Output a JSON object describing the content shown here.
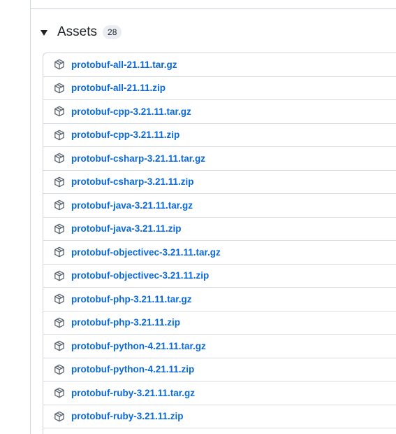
{
  "assets": {
    "title": "Assets",
    "count": "28",
    "items": [
      {
        "name": "protobuf-all-21.11.tar.gz",
        "icon": "package-icon"
      },
      {
        "name": "protobuf-all-21.11.zip",
        "icon": "package-icon"
      },
      {
        "name": "protobuf-cpp-3.21.11.tar.gz",
        "icon": "package-icon"
      },
      {
        "name": "protobuf-cpp-3.21.11.zip",
        "icon": "package-icon"
      },
      {
        "name": "protobuf-csharp-3.21.11.tar.gz",
        "icon": "package-icon"
      },
      {
        "name": "protobuf-csharp-3.21.11.zip",
        "icon": "package-icon"
      },
      {
        "name": "protobuf-java-3.21.11.tar.gz",
        "icon": "package-icon"
      },
      {
        "name": "protobuf-java-3.21.11.zip",
        "icon": "package-icon"
      },
      {
        "name": "protobuf-objectivec-3.21.11.tar.gz",
        "icon": "package-icon"
      },
      {
        "name": "protobuf-objectivec-3.21.11.zip",
        "icon": "package-icon"
      },
      {
        "name": "protobuf-php-3.21.11.tar.gz",
        "icon": "package-icon"
      },
      {
        "name": "protobuf-php-3.21.11.zip",
        "icon": "package-icon"
      },
      {
        "name": "protobuf-python-4.21.11.tar.gz",
        "icon": "package-icon"
      },
      {
        "name": "protobuf-python-4.21.11.zip",
        "icon": "package-icon"
      },
      {
        "name": "protobuf-ruby-3.21.11.tar.gz",
        "icon": "package-icon"
      },
      {
        "name": "protobuf-ruby-3.21.11.zip",
        "icon": "package-icon"
      },
      {
        "name": "",
        "icon": "package-icon"
      }
    ]
  },
  "colors": {
    "link": "#0969da",
    "border": "#d0d7de",
    "text": "#1f2328",
    "badge_bg": "#eaeef2",
    "icon": "#59636e"
  }
}
